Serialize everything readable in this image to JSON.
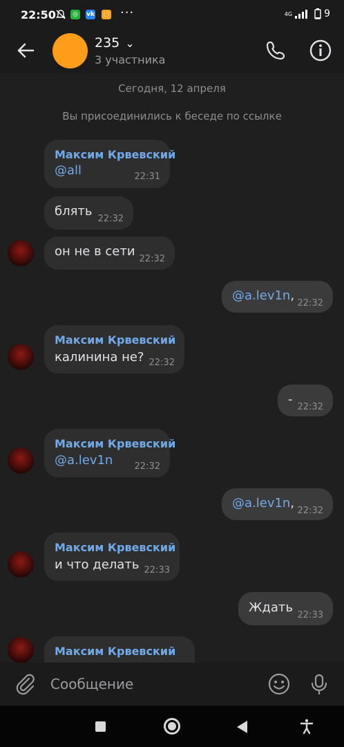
{
  "status": {
    "time": "22:50",
    "dots": "···",
    "battery": "9",
    "net": "4G"
  },
  "header": {
    "title": "235",
    "chevron": "⌄",
    "subtitle": "3 участника"
  },
  "chat": {
    "date": "Сегодня, 12 апреля",
    "system": "Вы присоединились к беседе по ссылке",
    "messages": [
      {
        "sender": "Максим Крвевский",
        "text": "@all",
        "time": "22:31"
      },
      {
        "text": "блять",
        "time": "22:32"
      },
      {
        "text": "он не в сети",
        "time": "22:32"
      },
      {
        "text": "@a.lev1n",
        "suffix": ",",
        "time": "22:32",
        "outgoing": true
      },
      {
        "sender": "Максим Крвевский",
        "text": "калинина не?",
        "time": "22:32"
      },
      {
        "text": "-",
        "time": "22:32",
        "outgoing": true
      },
      {
        "sender": "Максим Крвевский",
        "text": "@a.lev1n",
        "time": "22:32"
      },
      {
        "text": "@a.lev1n",
        "suffix": ",",
        "time": "22:32",
        "outgoing": true
      },
      {
        "sender": "Максим Крвевский",
        "text": "и что делать",
        "time": "22:33"
      },
      {
        "text": "Ждать",
        "time": "22:33",
        "outgoing": true
      },
      {
        "sender": "Максим Крвевский"
      }
    ]
  },
  "input": {
    "placeholder": "Сообщение"
  },
  "icons": {
    "back": "arrow-left-icon",
    "call": "phone-icon",
    "info": "info-icon",
    "attach": "paperclip-icon",
    "emoji": "smile-icon",
    "mic": "microphone-icon"
  },
  "colors": {
    "accent": "#71aaeb",
    "group_avatar": "#ff9c1a",
    "bubble_in": "#2e2e2e",
    "bubble_out": "#3b3b3b"
  }
}
